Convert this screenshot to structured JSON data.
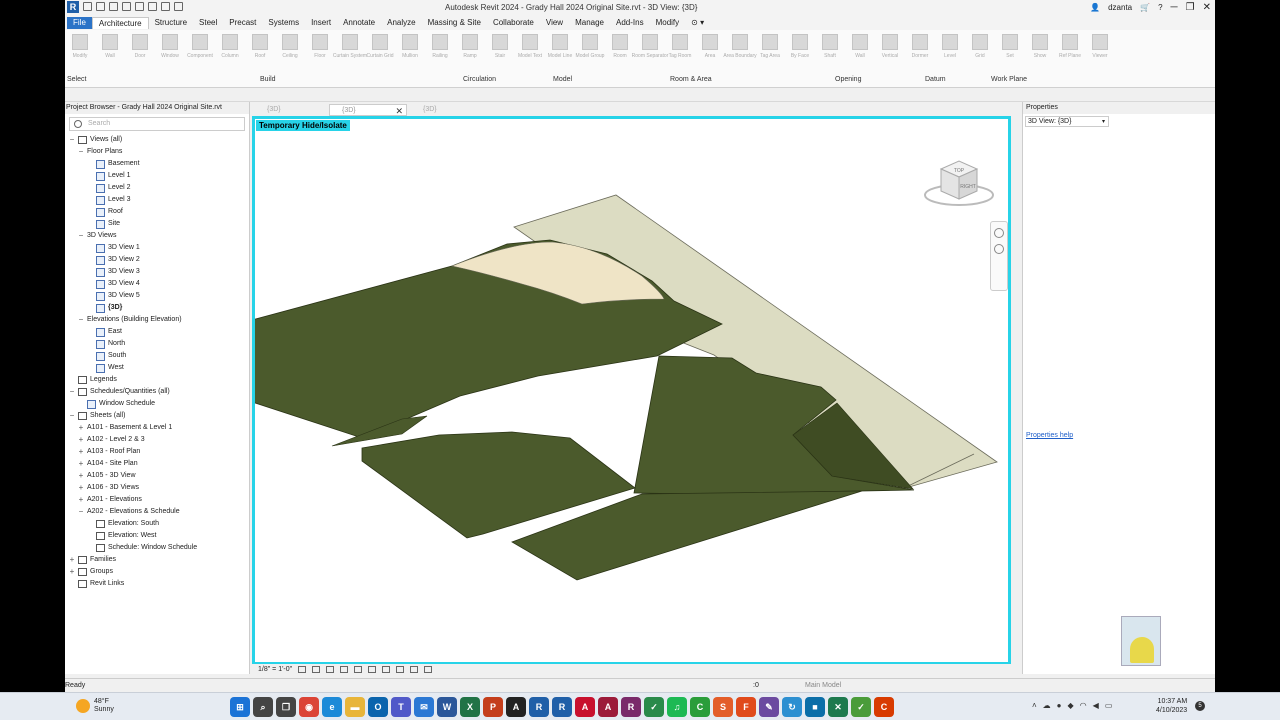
{
  "titlebar": {
    "title": "Autodesk Revit 2024 - Grady Hall 2024 Original Site.rvt - 3D View: {3D}",
    "user": "dzanta"
  },
  "ribbon": {
    "tabs": [
      "File",
      "Architecture",
      "Structure",
      "Steel",
      "Precast",
      "Systems",
      "Insert",
      "Annotate",
      "Analyze",
      "Massing & Site",
      "Collaborate",
      "View",
      "Manage",
      "Add-Ins",
      "Modify"
    ],
    "active_tab": "Architecture",
    "panels": [
      "Select",
      "Build",
      "Circulation",
      "Model",
      "Room & Area",
      "Opening",
      "Datum",
      "Work Plane"
    ],
    "buttons": [
      "Modify",
      "Wall",
      "Door",
      "Window",
      "Component",
      "Column",
      "Roof",
      "Ceiling",
      "Floor",
      "Curtain System",
      "Curtain Grid",
      "Mullion",
      "Railing",
      "Ramp",
      "Stair",
      "Model Text",
      "Model Line",
      "Model Group",
      "Room",
      "Room Separator",
      "Tag Room",
      "Area",
      "Area Boundary",
      "Tag Area",
      "By Face",
      "Shaft",
      "Wall",
      "Vertical",
      "Dormer",
      "Level",
      "Grid",
      "Set",
      "Show",
      "Ref Plane",
      "Viewer"
    ]
  },
  "project_browser": {
    "header": "Project Browser - Grady Hall 2024 Original Site.rvt",
    "search_placeholder": "Search",
    "tree": [
      {
        "label": "Views (all)",
        "depth": 0,
        "toggle": "−",
        "icon": "views"
      },
      {
        "label": "Floor Plans",
        "depth": 1,
        "toggle": "−",
        "icon": ""
      },
      {
        "label": "Basement",
        "depth": 2,
        "toggle": "",
        "icon": "view"
      },
      {
        "label": "Level 1",
        "depth": 2,
        "toggle": "",
        "icon": "view"
      },
      {
        "label": "Level 2",
        "depth": 2,
        "toggle": "",
        "icon": "view"
      },
      {
        "label": "Level 3",
        "depth": 2,
        "toggle": "",
        "icon": "view"
      },
      {
        "label": "Roof",
        "depth": 2,
        "toggle": "",
        "icon": "view"
      },
      {
        "label": "Site",
        "depth": 2,
        "toggle": "",
        "icon": "view"
      },
      {
        "label": "3D Views",
        "depth": 1,
        "toggle": "−",
        "icon": ""
      },
      {
        "label": "3D View 1",
        "depth": 2,
        "toggle": "",
        "icon": "view"
      },
      {
        "label": "3D View 2",
        "depth": 2,
        "toggle": "",
        "icon": "view"
      },
      {
        "label": "3D View 3",
        "depth": 2,
        "toggle": "",
        "icon": "view"
      },
      {
        "label": "3D View 4",
        "depth": 2,
        "toggle": "",
        "icon": "view"
      },
      {
        "label": "3D View 5",
        "depth": 2,
        "toggle": "",
        "icon": "view"
      },
      {
        "label": "{3D}",
        "depth": 2,
        "toggle": "",
        "icon": "view",
        "bold": true
      },
      {
        "label": "Elevations (Building Elevation)",
        "depth": 1,
        "toggle": "−",
        "icon": ""
      },
      {
        "label": "East",
        "depth": 2,
        "toggle": "",
        "icon": "view"
      },
      {
        "label": "North",
        "depth": 2,
        "toggle": "",
        "icon": "view"
      },
      {
        "label": "South",
        "depth": 2,
        "toggle": "",
        "icon": "view"
      },
      {
        "label": "West",
        "depth": 2,
        "toggle": "",
        "icon": "view"
      },
      {
        "label": "Legends",
        "depth": 0,
        "toggle": "",
        "icon": "sheet"
      },
      {
        "label": "Schedules/Quantities (all)",
        "depth": 0,
        "toggle": "−",
        "icon": "sheet"
      },
      {
        "label": "Window Schedule",
        "depth": 1,
        "toggle": "",
        "icon": "view"
      },
      {
        "label": "Sheets (all)",
        "depth": 0,
        "toggle": "−",
        "icon": "sheet"
      },
      {
        "label": "A101 - Basement & Level 1",
        "depth": 1,
        "toggle": "+",
        "icon": ""
      },
      {
        "label": "A102 - Level 2 & 3",
        "depth": 1,
        "toggle": "+",
        "icon": ""
      },
      {
        "label": "A103 - Roof Plan",
        "depth": 1,
        "toggle": "+",
        "icon": ""
      },
      {
        "label": "A104 - Site Plan",
        "depth": 1,
        "toggle": "+",
        "icon": ""
      },
      {
        "label": "A105 - 3D View",
        "depth": 1,
        "toggle": "+",
        "icon": ""
      },
      {
        "label": "A106 - 3D Views",
        "depth": 1,
        "toggle": "+",
        "icon": ""
      },
      {
        "label": "A201 - Elevations",
        "depth": 1,
        "toggle": "+",
        "icon": ""
      },
      {
        "label": "A202 - Elevations & Schedule",
        "depth": 1,
        "toggle": "−",
        "icon": ""
      },
      {
        "label": "Elevation: South",
        "depth": 2,
        "toggle": "",
        "icon": "house"
      },
      {
        "label": "Elevation: West",
        "depth": 2,
        "toggle": "",
        "icon": "house"
      },
      {
        "label": "Schedule: Window Schedule",
        "depth": 2,
        "toggle": "",
        "icon": "sheet"
      },
      {
        "label": "Families",
        "depth": 0,
        "toggle": "+",
        "icon": "sheet"
      },
      {
        "label": "Groups",
        "depth": 0,
        "toggle": "+",
        "icon": "sheet"
      },
      {
        "label": "Revit Links",
        "depth": 0,
        "toggle": "",
        "icon": "link"
      }
    ]
  },
  "view_tabs": [
    {
      "label": "{3D}",
      "active": false
    },
    {
      "label": "{3D}",
      "active": true
    },
    {
      "label": "{3D}",
      "active": false
    }
  ],
  "canvas": {
    "banner": "Temporary Hide/Isolate",
    "viewcube_face_top": "TOP",
    "viewcube_face_right": "RIGHT"
  },
  "view_control_bar": {
    "scale": "1/8\" = 1'-0\""
  },
  "properties": {
    "header": "Properties",
    "type_selector": "3D View: {3D}",
    "help_link": "Properties help"
  },
  "status_bar": {
    "ready": "Ready",
    "zero": ":0",
    "model": "Main Model"
  },
  "taskbar": {
    "weather_temp": "48°F",
    "weather_cond": "Sunny",
    "time": "10:37 AM",
    "date": "4/10/2023",
    "notification_count": "5",
    "apps": [
      {
        "name": "start",
        "glyph": "⊞",
        "color": "#1b73d6"
      },
      {
        "name": "search",
        "glyph": "⌕",
        "color": "#444"
      },
      {
        "name": "task-view",
        "glyph": "❐",
        "color": "#444"
      },
      {
        "name": "chrome",
        "glyph": "◉",
        "color": "#db4437"
      },
      {
        "name": "edge",
        "glyph": "e",
        "color": "#1c8ad8"
      },
      {
        "name": "file-explorer",
        "glyph": "▬",
        "color": "#e8b53a"
      },
      {
        "name": "outlook",
        "glyph": "O",
        "color": "#0a64ad"
      },
      {
        "name": "teams",
        "glyph": "T",
        "color": "#5059c9"
      },
      {
        "name": "mail",
        "glyph": "✉",
        "color": "#2b78d4"
      },
      {
        "name": "word",
        "glyph": "W",
        "color": "#2b579a"
      },
      {
        "name": "excel",
        "glyph": "X",
        "color": "#217346"
      },
      {
        "name": "powerpoint",
        "glyph": "P",
        "color": "#c43e1c"
      },
      {
        "name": "autocad",
        "glyph": "A",
        "color": "#222"
      },
      {
        "name": "revit-1",
        "glyph": "R",
        "color": "#1f5fa8"
      },
      {
        "name": "revit-2",
        "glyph": "R",
        "color": "#1f5fa8"
      },
      {
        "name": "autocad-2",
        "glyph": "A",
        "color": "#c8102e"
      },
      {
        "name": "autocad-3",
        "glyph": "A",
        "color": "#9c1b3a"
      },
      {
        "name": "revit-3",
        "glyph": "R",
        "color": "#7a2a6a"
      },
      {
        "name": "app-green",
        "glyph": "✓",
        "color": "#2a8a4a"
      },
      {
        "name": "spotify",
        "glyph": "♫",
        "color": "#1db954"
      },
      {
        "name": "app-c",
        "glyph": "C",
        "color": "#2a9d3a"
      },
      {
        "name": "app-s",
        "glyph": "S",
        "color": "#e35d2a"
      },
      {
        "name": "app-f",
        "glyph": "F",
        "color": "#e04a1c"
      },
      {
        "name": "app-pen",
        "glyph": "✎",
        "color": "#6b4aa0"
      },
      {
        "name": "app-refresh",
        "glyph": "↻",
        "color": "#2c8fd1"
      },
      {
        "name": "app-blue",
        "glyph": "■",
        "color": "#0b6ea8"
      },
      {
        "name": "app-x",
        "glyph": "✕",
        "color": "#1d7a4f"
      },
      {
        "name": "app-note",
        "glyph": "✓",
        "color": "#4a9c3a"
      },
      {
        "name": "app-c2",
        "glyph": "C",
        "color": "#d83b01"
      }
    ]
  }
}
